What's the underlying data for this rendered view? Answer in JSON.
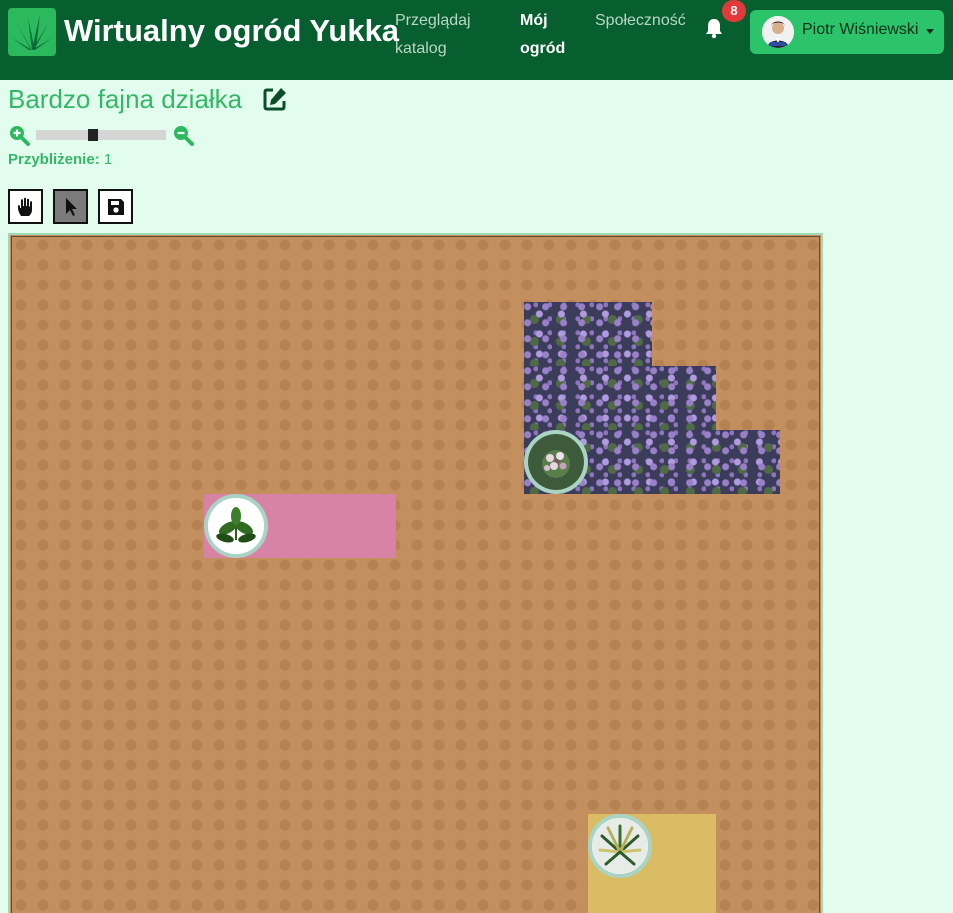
{
  "navbar": {
    "brand": "Wirtualny ogród Yukka",
    "links": [
      {
        "label": "Przeglądaj\nkatalog",
        "line1": "Przeglądaj",
        "line2": "katalog",
        "active": false
      },
      {
        "label": "Mój ogród",
        "line1": "Mój",
        "line2": "ogród",
        "active": true
      },
      {
        "label": "Społeczność",
        "line1": "Społeczność",
        "line2": "",
        "active": false
      }
    ],
    "notifications_count": "8",
    "user_name": "Piotr Wiśniewski"
  },
  "plot": {
    "title": "Bardzo fajna działka",
    "zoom_label": "Przybliżenie:",
    "zoom_value": "1",
    "zoom_level_fraction": 0.44
  },
  "tools": [
    {
      "name": "hand-tool",
      "icon": "hand-icon",
      "selected": false
    },
    {
      "name": "pointer-tool",
      "icon": "cursor-icon",
      "selected": true
    },
    {
      "name": "save-tool",
      "icon": "save-icon",
      "selected": false
    }
  ],
  "colors": {
    "navbar": "#075e2f",
    "accent": "#35b866",
    "user_button": "#2cc46a",
    "badge": "#e23a3a",
    "soil": "#c48f5e"
  },
  "beds": [
    {
      "plant": "lavender",
      "icon": "lavender-plant-icon"
    },
    {
      "plant": "pink-bed",
      "icon": "leafy-plant-icon"
    },
    {
      "plant": "yellow-bed",
      "icon": "spiky-plant-icon"
    }
  ]
}
